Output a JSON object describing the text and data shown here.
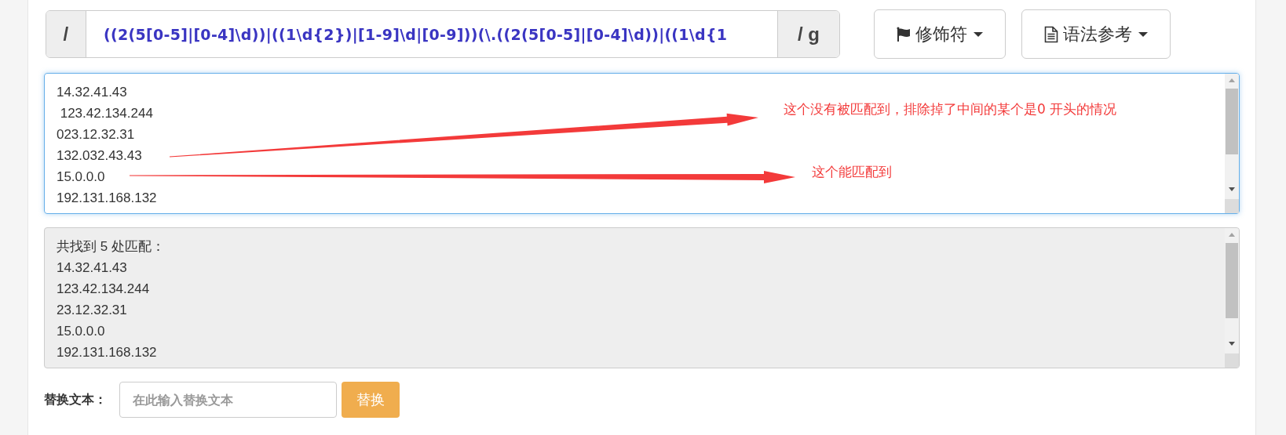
{
  "regex": {
    "prefix": "/",
    "pattern": "((2(5[0-5]|[0-4]\\d))|((1\\d{2})|[1-9]\\d|[0-9]))(\\.((2(5[0-5]|[0-4]\\d))|((1\\d{1",
    "suffix": "/ g"
  },
  "toolbar": [
    {
      "kind": "flag",
      "label": "修饰符"
    },
    {
      "kind": "document",
      "label": "语法参考"
    }
  ],
  "input_text": {
    "lines": [
      "14.32.41.43",
      " 123.42.134.244",
      "023.12.32.31",
      "132.032.43.43",
      "15.0.0.0",
      "192.131.168.132"
    ]
  },
  "annotations": [
    {
      "text": "这个没有被匹配到，排除掉了中间的某个是0 开头的情况"
    },
    {
      "text": "这个能匹配到"
    }
  ],
  "result": {
    "lines": [
      "共找到 5 处匹配：",
      "14.32.41.43",
      "123.42.134.244",
      "23.12.32.31",
      "15.0.0.0",
      "192.131.168.132"
    ]
  },
  "replace": {
    "label": "替换文本：",
    "placeholder": "在此输入替换文本",
    "button": "替换"
  }
}
